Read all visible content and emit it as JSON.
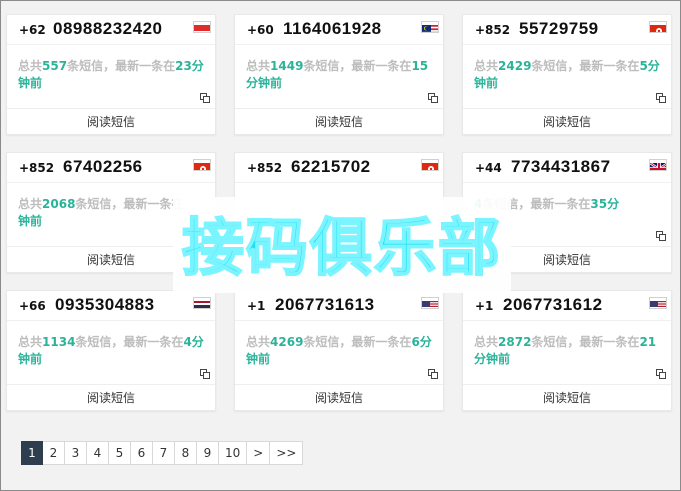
{
  "cards": [
    {
      "code": "+62",
      "number": "08988232420",
      "flag": "indonesia-flag",
      "info_prefix": "总共",
      "count": "557",
      "info_mid": "条短信，最新一条在",
      "age": "23",
      "info_unit_hl": "分",
      "info_suffix": "钟前",
      "read_label": "阅读短信"
    },
    {
      "code": "+60",
      "number": "1164061928",
      "flag": "malaysia-flag",
      "info_prefix": "总共",
      "count": "1449",
      "info_mid": "条短信，最新一条在",
      "age": "15",
      "info_unit_hl": "",
      "info_suffix": "分钟前",
      "read_label": "阅读短信"
    },
    {
      "code": "+852",
      "number": "55729759",
      "flag": "hongkong-flag",
      "info_prefix": "总共",
      "count": "2429",
      "info_mid": "条短信，最新一条在",
      "age": "5",
      "info_unit_hl": "分",
      "info_suffix": "钟前",
      "read_label": "阅读短信"
    },
    {
      "code": "+852",
      "number": "67402256",
      "flag": "hongkong-flag",
      "info_prefix": "总共",
      "count": "2068",
      "info_mid": "条短信，最新一条在",
      "age": "",
      "info_unit_hl": "",
      "info_suffix": "钟前",
      "read_label": "阅读短信"
    },
    {
      "code": "+852",
      "number": "62215702",
      "flag": "hongkong-flag",
      "info_prefix": "",
      "count": "",
      "info_mid": "",
      "age": "",
      "info_unit_hl": "",
      "info_suffix": "",
      "read_label": ""
    },
    {
      "code": "+44",
      "number": "7734431867",
      "flag": "uk-flag",
      "info_prefix": "",
      "count": "4",
      "info_mid": "条短信，最新一条在",
      "age": "35",
      "info_unit_hl": "分",
      "info_suffix": "",
      "read_label": "阅读短信"
    },
    {
      "code": "+66",
      "number": "0935304883",
      "flag": "thailand-flag",
      "info_prefix": "总共",
      "count": "1134",
      "info_mid": "条短信，最新一条在",
      "age": "4",
      "info_unit_hl": "分",
      "info_suffix": "钟前",
      "read_label": "阅读短信"
    },
    {
      "code": "+1",
      "number": "2067731613",
      "flag": "usa-flag",
      "info_prefix": "总共",
      "count": "4269",
      "info_mid": "条短信，最新一条在",
      "age": "6",
      "info_unit_hl": "分",
      "info_suffix": "钟前",
      "read_label": "阅读短信"
    },
    {
      "code": "+1",
      "number": "2067731612",
      "flag": "usa-flag",
      "info_prefix": "总共",
      "count": "2872",
      "info_mid": "条短信，最新一条在",
      "age": "21",
      "info_unit_hl": "",
      "info_suffix": "分钟前",
      "read_label": "阅读短信"
    }
  ],
  "watermark": {
    "text": "接码俱乐部",
    "color": "#22e0f0"
  },
  "pagination": [
    "1",
    "2",
    "3",
    "4",
    "5",
    "6",
    "7",
    "8",
    "9",
    "10",
    ">",
    ">>"
  ],
  "pagination_active": "1",
  "colors": {
    "highlight": "#2bb39a",
    "muted": "#bdbdbd",
    "active_page": "#2f3e4e"
  }
}
